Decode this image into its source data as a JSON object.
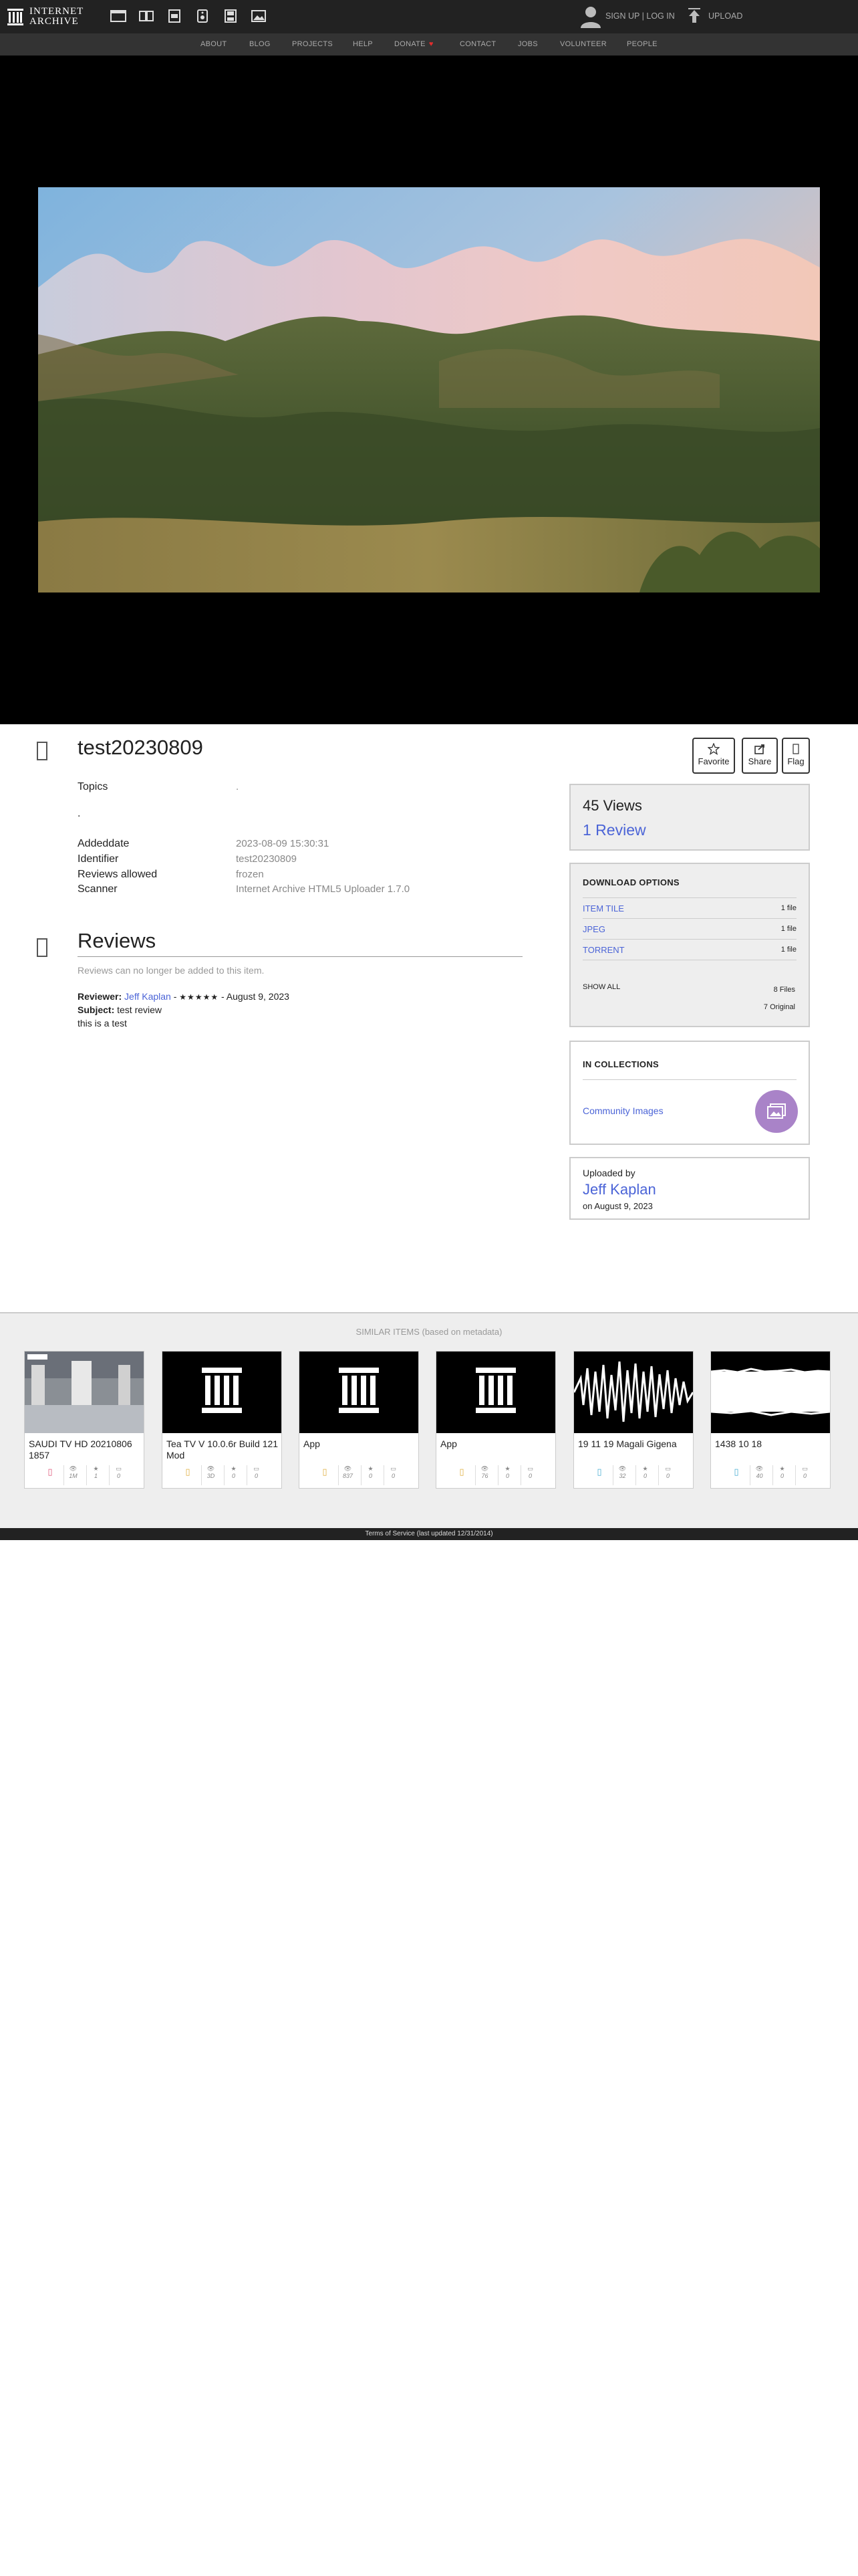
{
  "topbar": {
    "logo_line1": "INTERNET",
    "logo_line2": "ARCHIVE",
    "media_icons": [
      "web-icon",
      "texts-icon",
      "video-icon",
      "audio-icon",
      "software-icon",
      "images-icon"
    ],
    "signup": "SIGN UP | LOG IN",
    "upload": "UPLOAD"
  },
  "nav": {
    "items": [
      "ABOUT",
      "BLOG",
      "PROJECTS",
      "HELP",
      "DONATE",
      "CONTACT",
      "JOBS",
      "VOLUNTEER",
      "PEOPLE"
    ],
    "donate_heart": "♥"
  },
  "item": {
    "title": "test20230809",
    "actions": {
      "favorite": "Favorite",
      "share": "Share",
      "flag": "Flag"
    },
    "metadata": {
      "topics_label": "Topics",
      "topics_value": ".",
      "extra": ".",
      "addeddate_label": "Addeddate",
      "addeddate_value": "2023-08-09 15:30:31",
      "identifier_label": "Identifier",
      "identifier_value": "test20230809",
      "reviews_allowed_label": "Reviews allowed",
      "reviews_allowed_value": "frozen",
      "scanner_label": "Scanner",
      "scanner_value": "Internet Archive HTML5 Uploader 1.7.0"
    }
  },
  "reviews": {
    "heading": "Reviews",
    "note": "Reviews can no longer be added to this item.",
    "reviewer_label": "Reviewer:",
    "reviewer": "Jeff Kaplan",
    "separator": "-",
    "stars": "★★★★★",
    "date": "- August 9, 2023",
    "subject_label": "Subject:",
    "subject": "test review",
    "body": "this is a test"
  },
  "sidebar": {
    "views": "45 Views",
    "reviews_link": "1 Review",
    "download": {
      "heading": "DOWNLOAD OPTIONS",
      "rows": [
        {
          "label": "ITEM TILE",
          "count": "1 file"
        },
        {
          "label": "JPEG",
          "count": "1 file"
        },
        {
          "label": "TORRENT",
          "count": "1 file"
        }
      ],
      "show_all": "SHOW ALL",
      "files": "8 Files",
      "original": "7 Original"
    },
    "collections": {
      "heading": "IN COLLECTIONS",
      "name": "Community Images"
    },
    "uploader": {
      "by": "Uploaded by",
      "name": "Jeff Kaplan",
      "on": "on August 9, 2023"
    }
  },
  "similar": {
    "heading": "SIMILAR ITEMS (based on metadata)",
    "items": [
      {
        "title": "SAUDI TV HD 20210806 1857",
        "type_icon": "movies-icon",
        "views": "1M",
        "favs": "1",
        "reviews": "0",
        "color": "#e0577a"
      },
      {
        "title": "Tea TV V 10.0.6r Build 121 Mod",
        "type_icon": "software-icon",
        "views": "3D",
        "favs": "0",
        "reviews": "0",
        "color": "#e0b040"
      },
      {
        "title": "App",
        "type_icon": "software-icon",
        "views": "837",
        "favs": "0",
        "reviews": "0",
        "color": "#e0b040"
      },
      {
        "title": "App",
        "type_icon": "software-icon",
        "views": "76",
        "favs": "0",
        "reviews": "0",
        "color": "#e0b040"
      },
      {
        "title": "19 11 19 Magali Gigena",
        "type_icon": "audio-icon",
        "views": "32",
        "favs": "0",
        "reviews": "0",
        "color": "#49aed3"
      },
      {
        "title": "1438 10 18",
        "type_icon": "audio-icon",
        "views": "40",
        "favs": "0",
        "reviews": "0",
        "color": "#49aed3"
      }
    ]
  },
  "footer": "Terms of Service (last updated 12/31/2014)"
}
